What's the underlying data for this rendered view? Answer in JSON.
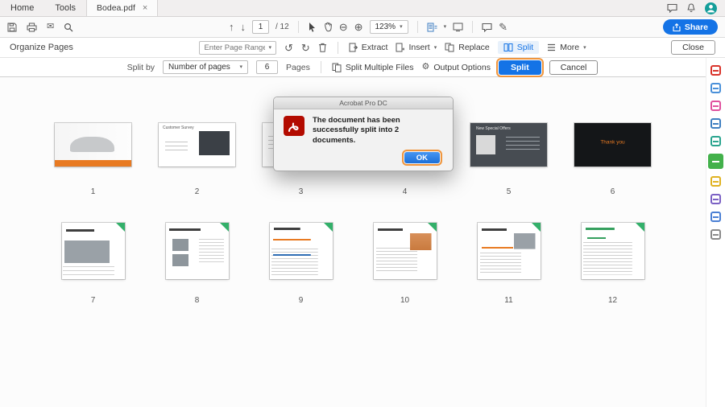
{
  "window": {
    "tabs": [
      {
        "label": "Home"
      },
      {
        "label": "Tools"
      }
    ],
    "doc_tab": {
      "label": "Bodea.pdf"
    }
  },
  "icons": {
    "caret": "▾",
    "close_tab": "×",
    "envelope": "✉",
    "pencil": "✎",
    "gear": "⚙",
    "rotate_left": "↺",
    "rotate_right": "↻",
    "zoom_out": "⊖",
    "zoom_in": "⊕",
    "page_up": "↑",
    "page_down": "↓"
  },
  "toolbar": {
    "page_current": "1",
    "page_total_label": "/ 12",
    "zoom": "123%",
    "share_label": "Share"
  },
  "organize": {
    "title": "Organize Pages",
    "range_placeholder": "Enter Page Range",
    "extract": "Extract",
    "insert": "Insert",
    "replace": "Replace",
    "split": "Split",
    "more": "More",
    "close": "Close"
  },
  "splitbar": {
    "label": "Split by",
    "mode": "Number of pages",
    "count": "6",
    "unit": "Pages",
    "multiple": "Split Multiple Files",
    "output": "Output Options",
    "split": "Split",
    "cancel": "Cancel"
  },
  "dialog": {
    "title": "Acrobat Pro DC",
    "message": "The document has been successfully split into 2 documents.",
    "ok": "OK"
  },
  "pages": [
    {
      "num": "1",
      "variant": "car"
    },
    {
      "num": "2",
      "variant": "survey",
      "label": "Customer Survey"
    },
    {
      "num": "3",
      "variant": "dark-split"
    },
    {
      "num": "4",
      "variant": "photo-dark"
    },
    {
      "num": "5",
      "variant": "offers",
      "label": "New Special Offers"
    },
    {
      "num": "6",
      "variant": "thankyou",
      "label": "Thank you"
    },
    {
      "num": "7",
      "variant": "doc-photo"
    },
    {
      "num": "8",
      "variant": "doc-people"
    },
    {
      "num": "9",
      "variant": "doc-table"
    },
    {
      "num": "10",
      "variant": "doc-flyer"
    },
    {
      "num": "11",
      "variant": "doc-flyer2"
    },
    {
      "num": "12",
      "variant": "doc-text"
    }
  ],
  "tools_panel": [
    {
      "name": "export-pdf",
      "color": "#d9342b"
    },
    {
      "name": "create-pdf",
      "color": "#4a90d9"
    },
    {
      "name": "edit-pdf",
      "color": "#e0519e"
    },
    {
      "name": "combine-files",
      "color": "#3f7fc1"
    },
    {
      "name": "enhance-scans",
      "color": "#2aa58f"
    },
    {
      "name": "organize-pages",
      "color": "#43b14b",
      "active": true
    },
    {
      "name": "comment",
      "color": "#e0b322"
    },
    {
      "name": "fill-sign",
      "color": "#7b61c4"
    },
    {
      "name": "protect",
      "color": "#4a7fd4"
    },
    {
      "name": "more-tools",
      "color": "#8a8a8a"
    }
  ],
  "colors": {
    "accent": "#1473e6",
    "highlight_ring": "#f0953c",
    "active_tool": "#43b14b",
    "avatar": "#149e9a"
  }
}
